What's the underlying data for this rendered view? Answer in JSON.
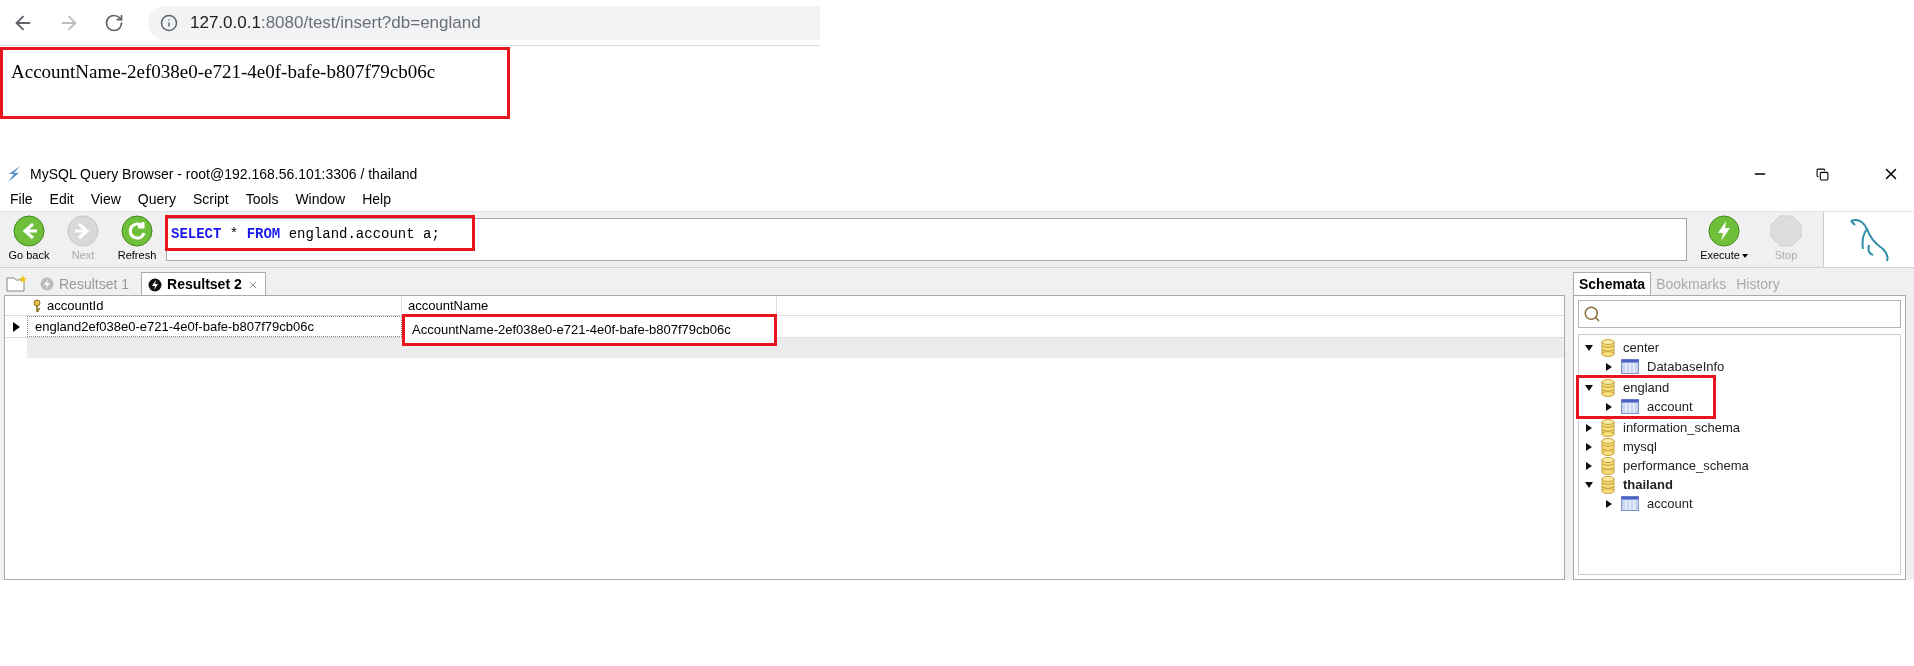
{
  "browser": {
    "url_host": "127.0.0.1",
    "url_rest": ":8080/test/insert?db=england",
    "page_text": {
      "text": "AccountName-2ef038e0-e721-4e0f-bafe-b807f79cb06c",
      "highlighted": true
    }
  },
  "app": {
    "title": "MySQL Query Browser - root@192.168.56.101:3306 / thailand",
    "menu": [
      "File",
      "Edit",
      "View",
      "Query",
      "Script",
      "Tools",
      "Window",
      "Help"
    ],
    "nav_buttons": [
      {
        "label": "Go back",
        "kind": "back",
        "disabled": false
      },
      {
        "label": "Next",
        "kind": "next",
        "disabled": true
      },
      {
        "label": "Refresh",
        "kind": "refresh",
        "disabled": false
      }
    ],
    "query": {
      "highlighted": true,
      "tokens": [
        {
          "text": "SELECT",
          "kind": "keyword"
        },
        {
          "text": " * ",
          "kind": "plain"
        },
        {
          "text": "FROM",
          "kind": "keyword"
        },
        {
          "text": " england.account a;",
          "kind": "plain"
        }
      ]
    },
    "run_buttons": [
      {
        "label": "Execute",
        "kind": "execute",
        "disabled": false,
        "dropdown": true
      },
      {
        "label": "Stop",
        "kind": "stop",
        "disabled": true,
        "dropdown": false
      }
    ],
    "result_tabs": [
      {
        "label": "Resultset 1",
        "selected": false
      },
      {
        "label": "Resultset 2",
        "selected": true
      }
    ],
    "table": {
      "columns": [
        {
          "label": "accountId",
          "key": true
        },
        {
          "label": "accountName",
          "key": false
        }
      ],
      "rows": [
        {
          "current": true,
          "cells": [
            {
              "text": "england2ef038e0-e721-4e0f-bafe-b807f79cb06c",
              "highlighted": false
            },
            {
              "text": "AccountName-2ef038e0-e721-4e0f-bafe-b807f79cb06c",
              "highlighted": true
            }
          ]
        }
      ]
    },
    "side_tabs": [
      {
        "label": "Schemata",
        "selected": true
      },
      {
        "label": "Bookmarks",
        "selected": false
      },
      {
        "label": "History",
        "selected": false
      }
    ],
    "schemata": [
      {
        "label": "center",
        "kind": "schema",
        "expanded": true,
        "default": false,
        "highlighted": false,
        "children": [
          {
            "label": "DatabaseInfo",
            "kind": "table",
            "expanded": false
          }
        ]
      },
      {
        "label": "england",
        "kind": "schema",
        "expanded": true,
        "default": false,
        "highlighted": true,
        "children": [
          {
            "label": "account",
            "kind": "table",
            "expanded": false
          }
        ]
      },
      {
        "label": "information_schema",
        "kind": "schema",
        "expanded": false,
        "default": false,
        "highlighted": false
      },
      {
        "label": "mysql",
        "kind": "schema",
        "expanded": false,
        "default": false,
        "highlighted": false
      },
      {
        "label": "performance_schema",
        "kind": "schema",
        "expanded": false,
        "default": false,
        "highlighted": false
      },
      {
        "label": "thailand",
        "kind": "schema",
        "expanded": true,
        "default": true,
        "highlighted": false,
        "children": [
          {
            "label": "account",
            "kind": "table",
            "expanded": false
          }
        ]
      }
    ]
  }
}
